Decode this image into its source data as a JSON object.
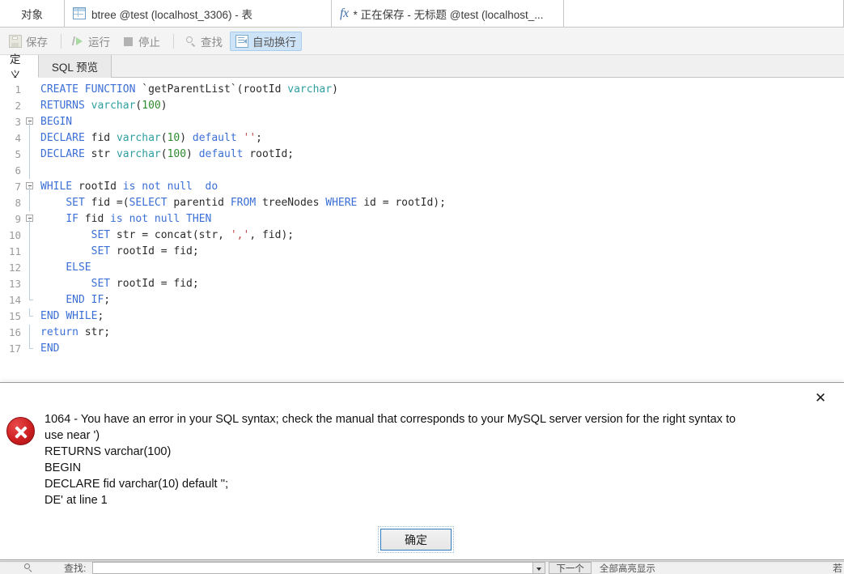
{
  "window": {
    "tabs": [
      {
        "name": "object-tab",
        "label": "对象",
        "icon": null,
        "active": false
      },
      {
        "name": "btree-tab",
        "label": "btree @test (localhost_3306) - 表",
        "icon": "grid-icon",
        "active": false
      },
      {
        "name": "function-tab",
        "label": "* 正在保存 - 无标题 @test (localhost_...",
        "icon": "fx-icon",
        "active": true
      }
    ]
  },
  "toolbar": {
    "items": [
      {
        "name": "save-button",
        "label": "保存",
        "icon": "save-icon",
        "enabled": false,
        "toggled": false
      },
      {
        "name": "run-button",
        "label": "运行",
        "icon": "play-icon",
        "enabled": false,
        "toggled": false
      },
      {
        "name": "stop-button",
        "label": "停止",
        "icon": "stop-icon",
        "enabled": false,
        "toggled": false
      },
      {
        "name": "find-button",
        "label": "查找",
        "icon": "search-icon",
        "enabled": false,
        "toggled": false
      },
      {
        "name": "word-wrap-button",
        "label": "自动换行",
        "icon": "wrap-icon",
        "enabled": true,
        "toggled": true
      }
    ]
  },
  "inner_tabs": [
    {
      "name": "tab-definition",
      "label": "定义",
      "active": true
    },
    {
      "name": "tab-sql-preview",
      "label": "SQL 预览",
      "active": false
    }
  ],
  "editor": {
    "language": "sql",
    "lines": [
      {
        "n": "1",
        "fold": "none",
        "tokens": [
          {
            "t": "CREATE",
            "c": "kw"
          },
          {
            "t": " ",
            "c": "pln"
          },
          {
            "t": "FUNCTION",
            "c": "kw"
          },
          {
            "t": " `getParentList`(rootId ",
            "c": "pln"
          },
          {
            "t": "varchar",
            "c": "typ"
          },
          {
            "t": ")",
            "c": "pln"
          }
        ]
      },
      {
        "n": "2",
        "fold": "none",
        "tokens": [
          {
            "t": "RETURNS",
            "c": "kw"
          },
          {
            "t": " ",
            "c": "pln"
          },
          {
            "t": "varchar",
            "c": "typ"
          },
          {
            "t": "(",
            "c": "pln"
          },
          {
            "t": "100",
            "c": "num"
          },
          {
            "t": ")",
            "c": "pln"
          }
        ]
      },
      {
        "n": "3",
        "fold": "start",
        "tokens": [
          {
            "t": "BEGIN",
            "c": "kw"
          }
        ]
      },
      {
        "n": "4",
        "fold": "line",
        "tokens": [
          {
            "t": "DECLARE",
            "c": "kw"
          },
          {
            "t": " fid ",
            "c": "pln"
          },
          {
            "t": "varchar",
            "c": "typ"
          },
          {
            "t": "(",
            "c": "pln"
          },
          {
            "t": "10",
            "c": "num"
          },
          {
            "t": ") ",
            "c": "pln"
          },
          {
            "t": "default",
            "c": "kw"
          },
          {
            "t": " ",
            "c": "pln"
          },
          {
            "t": "''",
            "c": "str"
          },
          {
            "t": ";",
            "c": "pln"
          }
        ]
      },
      {
        "n": "5",
        "fold": "line",
        "tokens": [
          {
            "t": "DECLARE",
            "c": "kw"
          },
          {
            "t": " str ",
            "c": "pln"
          },
          {
            "t": "varchar",
            "c": "typ"
          },
          {
            "t": "(",
            "c": "pln"
          },
          {
            "t": "100",
            "c": "num"
          },
          {
            "t": ") ",
            "c": "pln"
          },
          {
            "t": "default",
            "c": "kw"
          },
          {
            "t": " rootId;",
            "c": "pln"
          }
        ]
      },
      {
        "n": "6",
        "fold": "line",
        "tokens": [
          {
            "t": "",
            "c": "pln"
          }
        ]
      },
      {
        "n": "7",
        "fold": "start",
        "tokens": [
          {
            "t": "WHILE",
            "c": "kw"
          },
          {
            "t": " rootId ",
            "c": "pln"
          },
          {
            "t": "is",
            "c": "kw"
          },
          {
            "t": " ",
            "c": "pln"
          },
          {
            "t": "not",
            "c": "kw"
          },
          {
            "t": " ",
            "c": "pln"
          },
          {
            "t": "null",
            "c": "kw"
          },
          {
            "t": "  ",
            "c": "pln"
          },
          {
            "t": "do",
            "c": "kw"
          }
        ]
      },
      {
        "n": "8",
        "fold": "line",
        "tokens": [
          {
            "t": "    ",
            "c": "pln"
          },
          {
            "t": "SET",
            "c": "kw"
          },
          {
            "t": " fid =(",
            "c": "pln"
          },
          {
            "t": "SELECT",
            "c": "kw"
          },
          {
            "t": " parentid ",
            "c": "pln"
          },
          {
            "t": "FROM",
            "c": "kw"
          },
          {
            "t": " treeNodes ",
            "c": "pln"
          },
          {
            "t": "WHERE",
            "c": "kw"
          },
          {
            "t": " id = rootId);",
            "c": "pln"
          }
        ]
      },
      {
        "n": "9",
        "fold": "start2",
        "tokens": [
          {
            "t": "    ",
            "c": "pln"
          },
          {
            "t": "IF",
            "c": "kw"
          },
          {
            "t": " fid ",
            "c": "pln"
          },
          {
            "t": "is",
            "c": "kw"
          },
          {
            "t": " ",
            "c": "pln"
          },
          {
            "t": "not",
            "c": "kw"
          },
          {
            "t": " ",
            "c": "pln"
          },
          {
            "t": "null",
            "c": "kw"
          },
          {
            "t": " ",
            "c": "pln"
          },
          {
            "t": "THEN",
            "c": "kw"
          }
        ]
      },
      {
        "n": "10",
        "fold": "line",
        "tokens": [
          {
            "t": "        ",
            "c": "pln"
          },
          {
            "t": "SET",
            "c": "kw"
          },
          {
            "t": " str = concat(str, ",
            "c": "pln"
          },
          {
            "t": "','",
            "c": "str"
          },
          {
            "t": ", fid);",
            "c": "pln"
          }
        ]
      },
      {
        "n": "11",
        "fold": "line",
        "tokens": [
          {
            "t": "        ",
            "c": "pln"
          },
          {
            "t": "SET",
            "c": "kw"
          },
          {
            "t": " rootId = fid;",
            "c": "pln"
          }
        ]
      },
      {
        "n": "12",
        "fold": "line",
        "tokens": [
          {
            "t": "    ",
            "c": "pln"
          },
          {
            "t": "ELSE",
            "c": "kw"
          }
        ]
      },
      {
        "n": "13",
        "fold": "line",
        "tokens": [
          {
            "t": "        ",
            "c": "pln"
          },
          {
            "t": "SET",
            "c": "kw"
          },
          {
            "t": " rootId = fid;",
            "c": "pln"
          }
        ]
      },
      {
        "n": "14",
        "fold": "end2",
        "tokens": [
          {
            "t": "    ",
            "c": "pln"
          },
          {
            "t": "END",
            "c": "kw"
          },
          {
            "t": " ",
            "c": "pln"
          },
          {
            "t": "IF",
            "c": "kw"
          },
          {
            "t": ";",
            "c": "pln"
          }
        ]
      },
      {
        "n": "15",
        "fold": "end",
        "tokens": [
          {
            "t": "END",
            "c": "kw"
          },
          {
            "t": " ",
            "c": "pln"
          },
          {
            "t": "WHILE",
            "c": "kw"
          },
          {
            "t": ";",
            "c": "pln"
          }
        ]
      },
      {
        "n": "16",
        "fold": "line",
        "tokens": [
          {
            "t": "return",
            "c": "kw"
          },
          {
            "t": " str;",
            "c": "pln"
          }
        ]
      },
      {
        "n": "17",
        "fold": "end",
        "tokens": [
          {
            "t": "END",
            "c": "kw"
          }
        ]
      }
    ]
  },
  "dialog": {
    "name": "sql-error-dialog",
    "close_label": "✕",
    "icon": "error-icon",
    "message_lines": [
      "1064 - You have an error in your SQL syntax; check the manual that corresponds to your MySQL server version for the right syntax to",
      "use near ')",
      "RETURNS varchar(100)",
      "BEGIN",
      "DECLARE fid varchar(10) default '';",
      "DE' at line 1"
    ],
    "ok_label": "确定"
  },
  "findbar": {
    "label": "查找:",
    "input_value": "",
    "prev_next_label": "下一个",
    "highlight_all_label": "全部高亮显示",
    "right_label": "若"
  },
  "colors": {
    "accent": "#2f7dc0",
    "toggle_bg": "#cde3f7",
    "error_red": "#cc1e20",
    "keyword": "#3b6fd6",
    "type": "#2e9fa0",
    "number": "#2e8b2e",
    "string": "#c04a4a"
  }
}
